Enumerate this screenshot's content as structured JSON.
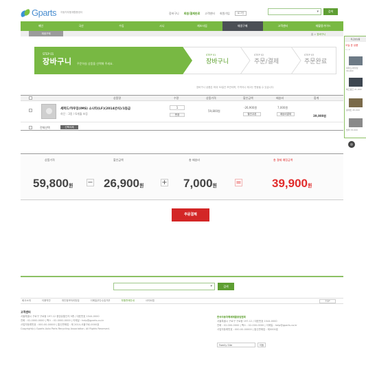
{
  "header": {
    "logo_text": "Gparts",
    "logo_sub": "자동차부품재활용센터",
    "util_links": [
      "장바구니",
      "회원/결제완료",
      "고객센터",
      "회원가입",
      "로그인"
    ],
    "util_highlight_index": 1,
    "util_button": "로그인",
    "search_button": "검색"
  },
  "nav": {
    "items": [
      "메인",
      "국산",
      "수입",
      "시니",
      "재조사업",
      "재생구매",
      "고객센터",
      "재활용가이드"
    ],
    "dark_index": 5,
    "sub_tab": "재생구매",
    "breadcrumb_prefix": "홈 > ",
    "breadcrumb_current": "장바구니"
  },
  "steps": {
    "active": {
      "step": "STEP 01",
      "title": "장바구니",
      "desc": "주문하실 상품을 선택해 주세요."
    },
    "items": [
      {
        "step": "STEP 01",
        "title": "장바구니"
      },
      {
        "step": "STEP 02",
        "title": "주문/결제"
      },
      {
        "step": "STEP 03",
        "title": "주문완료"
      }
    ]
  },
  "cart": {
    "note": "장바구니 상품은 최대 30일간 보관되며, 가격이나 재고는 변동될 수 있습니다.",
    "headers": [
      "선택",
      "상품명",
      "수량",
      "상품가격",
      "할인금액",
      "배송비",
      "합계"
    ],
    "items": [
      {
        "name": "세퍼드/하우징(IMS) 소나타(LF)(2014년식)/1등급",
        "option": "하단 : 3정 / 6개월 보증",
        "qty": "1",
        "qty_button": "변경",
        "price": "59,800원",
        "discount": "-26,900원",
        "discount_button": "할인쿠폰",
        "shipping": "7,000원",
        "shipping_button": "배송비결제",
        "total": "39,900원"
      }
    ],
    "select_all": "전체선택",
    "delete_button": "선택삭제"
  },
  "totals": {
    "labels": [
      "상품가격",
      "할인금액",
      "총 배송비",
      "총 결제 예정금액"
    ],
    "values": [
      "59,800",
      "26,900",
      "7,000",
      "39,900"
    ],
    "unit": "원",
    "ops": [
      "−",
      "+",
      "="
    ]
  },
  "order_button": "주문결제",
  "footer": {
    "search_button": "검색",
    "links": [
      "회사소개",
      "이용약관",
      "개인정보처리방침",
      "이메일무단수집거부",
      "부품판매안내",
      "사이트맵"
    ],
    "link_highlight_index": 4,
    "top_button": "TOP",
    "cs_title": "고객센터",
    "address_lines": [
      "서울특별시 구로구 구로동 197-12 중앙유통단지 5층 / 대표번호 1544-0000",
      "전화 : 02-0000-0000 | 팩스 : 02-0000-0000 | 이메일 : help@gparts.co.kr",
      "사업자등록번호 : 000-00-00000 | 통신판매업 : 제 2014-서울구로-0000호",
      "Copyright(c) Gparts Auto Parts Recycling Association. All Rights Reserved."
    ],
    "partner_title": "한국자동차해체재활용업협회",
    "partner_lines": [
      "서울특별시 구로구 구로동 197-12 / 대표번호 1544-0000",
      "전화 : 02-000-0000 | 팩스 : 02-000-0000 | 이메일 : help@gparts.co.kr",
      "사업자등록번호 : 000-00-00000 | 통신판매업 : 제0000호"
    ],
    "family_select": "Family Site",
    "family_go": "이동"
  },
  "quick": {
    "head": "최근본상품",
    "sub": "오늘 본 상품",
    "sub2": "1 / 2",
    "items": [
      {
        "cap": "세퍼드/하우징 39,900",
        "color": "#6d7a86"
      },
      {
        "cap": "헤드램프 21,000",
        "color": "#3d4650"
      },
      {
        "cap": "휠세트 45,000",
        "color": "#7a6a4a"
      },
      {
        "cap": "범퍼 33,000",
        "color": "#8a8a8a"
      }
    ]
  }
}
